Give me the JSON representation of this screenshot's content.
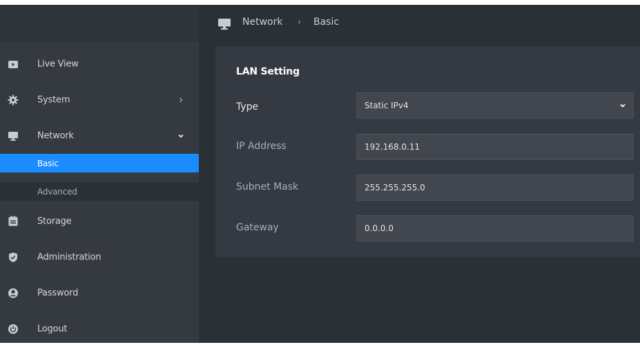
{
  "breadcrumb": {
    "section": "Network",
    "separator": "›",
    "page": "Basic",
    "icon": "monitor-icon"
  },
  "sidebar": {
    "items": [
      {
        "label": "Live View",
        "icon": "camera-icon"
      },
      {
        "label": "System",
        "icon": "gear-icon",
        "chevron": "chevron-right-icon"
      },
      {
        "label": "Network",
        "icon": "monitor-icon",
        "chevron": "chevron-down-icon"
      },
      {
        "label": "Storage",
        "icon": "storage-icon"
      },
      {
        "label": "Administration",
        "icon": "shield-icon"
      },
      {
        "label": "Password",
        "icon": "user-icon"
      },
      {
        "label": "Logout",
        "icon": "power-icon"
      }
    ],
    "network_sub": [
      {
        "label": "Basic",
        "active": true
      },
      {
        "label": "Advanced",
        "active": false
      }
    ]
  },
  "lan": {
    "title": "LAN Setting",
    "type": {
      "label": "Type",
      "value": "Static IPv4"
    },
    "ip": {
      "label": "IP Address",
      "value": "192.168.0.11"
    },
    "subnet": {
      "label": "Subnet Mask",
      "value": "255.255.255.0"
    },
    "gateway": {
      "label": "Gateway",
      "value": "0.0.0.0"
    }
  },
  "colors": {
    "accent": "#1a8cff",
    "sidebar": "#353940",
    "main": "#2b2f36",
    "card": "#353a42",
    "field": "#41464f"
  }
}
